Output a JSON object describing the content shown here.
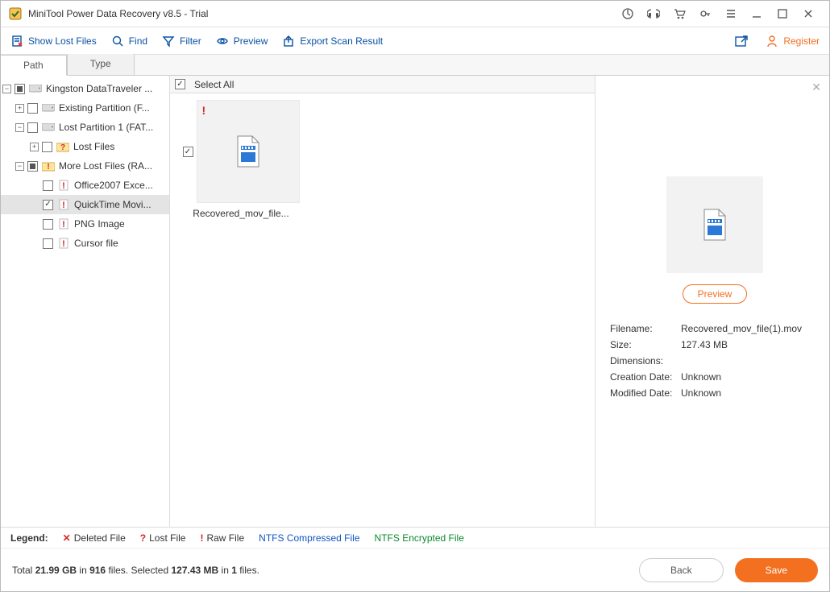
{
  "titlebar": {
    "title": "MiniTool Power Data Recovery v8.5 - Trial"
  },
  "toolbar": {
    "show_lost_files": "Show Lost Files",
    "find": "Find",
    "filter": "Filter",
    "preview": "Preview",
    "export": "Export Scan Result",
    "register": "Register"
  },
  "tabs": {
    "path": "Path",
    "type": "Type"
  },
  "tree": {
    "root": {
      "label": "Kingston DataTraveler ..."
    },
    "part_existing": {
      "label": "Existing Partition (F..."
    },
    "part_lost": {
      "label": "Lost Partition 1 (FAT..."
    },
    "lost_files": {
      "label": "Lost Files"
    },
    "more_lost": {
      "label": "More Lost Files (RA..."
    },
    "office": {
      "label": "Office2007 Exce..."
    },
    "quicktime": {
      "label": "QuickTime Movi..."
    },
    "png": {
      "label": "PNG Image"
    },
    "cursor": {
      "label": "Cursor file"
    }
  },
  "filepane": {
    "select_all": "Select All",
    "items": [
      {
        "name": "Recovered_mov_file..."
      }
    ]
  },
  "details": {
    "preview_btn": "Preview",
    "rows": {
      "filename_label": "Filename:",
      "filename_value": "Recovered_mov_file(1).mov",
      "size_label": "Size:",
      "size_value": "127.43 MB",
      "dimensions_label": "Dimensions:",
      "dimensions_value": "",
      "created_label": "Creation Date:",
      "created_value": "Unknown",
      "modified_label": "Modified Date:",
      "modified_value": "Unknown"
    }
  },
  "legend": {
    "title": "Legend:",
    "deleted": "Deleted File",
    "lost": "Lost File",
    "raw": "Raw File",
    "ntfs_compressed": "NTFS Compressed File",
    "ntfs_encrypted": "NTFS Encrypted File"
  },
  "footer": {
    "total_prefix": "Total ",
    "total_size": "21.99 GB",
    "total_in": " in ",
    "total_files": "916",
    "total_suffix": " files.  Selected ",
    "sel_size": "127.43 MB",
    "sel_in": " in ",
    "sel_files": "1",
    "sel_suffix": " files.",
    "back": "Back",
    "save": "Save"
  }
}
